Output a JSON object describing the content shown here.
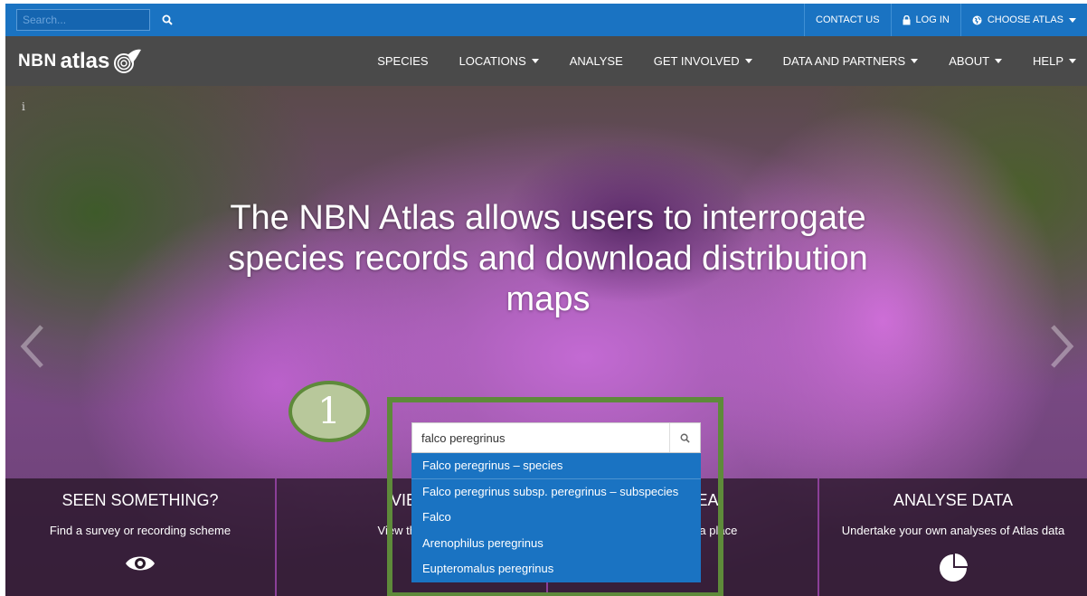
{
  "topbar": {
    "search_placeholder": "Search...",
    "links": [
      {
        "label": "CONTACT US"
      },
      {
        "label": "LOG IN"
      },
      {
        "label": "CHOOSE ATLAS"
      }
    ]
  },
  "logo": {
    "part1": "NBN",
    "part2": "atlas"
  },
  "nav": {
    "items": [
      {
        "label": "SPECIES"
      },
      {
        "label": "LOCATIONS"
      },
      {
        "label": "ANALYSE"
      },
      {
        "label": "GET INVOLVED"
      },
      {
        "label": "DATA AND PARTNERS"
      },
      {
        "label": "ABOUT"
      },
      {
        "label": "HELP"
      }
    ]
  },
  "hero": {
    "title": "The NBN Atlas allows users to interrogate species records and download distribution maps",
    "info_glyph": "i"
  },
  "search": {
    "value": "falco peregrinus",
    "suggestions": [
      "Falco peregrinus – species",
      "Falco peregrinus subsp. peregrinus – subspecies",
      "Falco",
      "Arenophilus peregrinus",
      "Eupteromalus peregrinus"
    ]
  },
  "tiles": [
    {
      "title": "SEEN SOMETHING?",
      "desc": "Find a survey or recording scheme"
    },
    {
      "title": "VIEW",
      "desc": "View the Atla"
    },
    {
      "title": "UR AREA",
      "desc": "ma ion about a place"
    },
    {
      "title": "ANALYSE DATA",
      "desc": "Undertake your own analyses of Atlas data"
    }
  ],
  "annotation": {
    "step": "1"
  },
  "colors": {
    "topbar": "#1a73c2",
    "navbar": "#4a4a4a",
    "highlight": "#5e8a3a",
    "dropdown": "#1a73c2"
  }
}
